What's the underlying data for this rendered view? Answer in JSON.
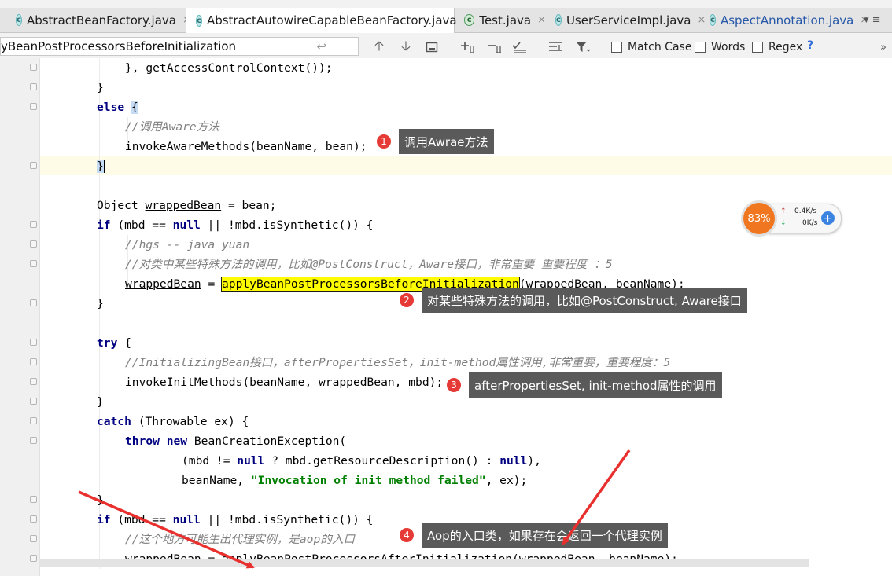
{
  "tabs": [
    {
      "label": "AbstractBeanFactory.java",
      "icon": "class-icon",
      "close": "×"
    },
    {
      "label": "AbstractAutowireCapableBeanFactory.java",
      "icon": "class-icon",
      "close": "×"
    },
    {
      "label": "Test.java",
      "icon": "test-class-icon",
      "close": "×"
    },
    {
      "label": "UserServiceImpl.java",
      "icon": "class-icon",
      "close": "×"
    },
    {
      "label": "AspectAnnotation.java",
      "icon": "class-icon",
      "close": "×"
    }
  ],
  "tab_more": "▾ ≡",
  "find": {
    "query": "yBeanPostProcessorsBeforeInitialization",
    "enter_glyph": "↩",
    "match_case_label": "Match Case",
    "words_label": "Words",
    "regex_label": "Regex",
    "help": "?",
    "more": "»"
  },
  "code": {
    "l1_text": "}, getAccessControlContext());",
    "brace_close": "}",
    "else_kw": "else",
    "brace_open": "{",
    "l4_comment": "//调用Aware方法",
    "l5_text": "invokeAwareMethods(beanName, bean);",
    "l8_a": "Object ",
    "l8_var": "wrappedBean",
    "l8_b": " = bean;",
    "if_kw": "if",
    "if_a": " (mbd == ",
    "null_kw": "null",
    "if_b": " || !mbd.isSynthetic()) {",
    "l10_comment": "//hgs -- java yuan",
    "l11_comment": "//对类中某些特殊方法的调用，比如@PostConstruct，Aware接口，非常重要 重要程度 ：5",
    "l12_var": "wrappedBean",
    "l12_eq": " = ",
    "l12_hl": "applyBeanPostProcessorsBeforeInitialization",
    "l12_rest": "(wrappedBean, beanName);",
    "try_kw": "try",
    "try_rest": " {",
    "l16_comment": "//InitializingBean接口，afterPropertiesSet，init-method属性调用,非常重要，重要程度：5",
    "l17_a": "invokeInitMethods(beanName, ",
    "l17_var": "wrappedBean",
    "l17_b": ", mbd);",
    "catch_kw": "catch",
    "catch_rest": " (Throwable ex) {",
    "throw_kw": "throw",
    "new_kw": "new",
    "l20_rest": " BeanCreationException(",
    "l21_a": "(mbd != ",
    "l21_b": " ? mbd.getResourceDescription() : ",
    "l21_c": "),",
    "l22_a": "beanName, ",
    "l22_str": "\"Invocation of init method failed\"",
    "l22_b": ", ex);",
    "if2_a": " (mbd == ",
    "l25_comment": "//这个地方可能生出代理实例，是aop的入口",
    "l26_var": "wrappedBean",
    "l26_eq": " = applyBeanPostProcessorsAfterInitialization(",
    "l26_var2": "wrappedBean",
    "l26_rest": ", beanName);"
  },
  "callouts": [
    {
      "num": "1",
      "text": "调用Awrae方法"
    },
    {
      "num": "2",
      "text": "对某些特殊方法的调用，比如@PostConstruct, Aware接口"
    },
    {
      "num": "3",
      "text": "afterPropertiesSet, init-method属性的调用"
    },
    {
      "num": "4",
      "text": "Aop的入口类，如果存在会返回一个代理实例"
    }
  ],
  "net_widget": {
    "percent": "83%",
    "upload": "0.4K/s",
    "download": "0K/s",
    "up_arrow": "↑",
    "down_arrow": "↓",
    "plus": "+"
  },
  "colors": {
    "keyword": "#000080",
    "comment": "#808080",
    "string": "#008000",
    "highlight": "#fffb00",
    "callout_bg": "#5a5a5a",
    "badge": "#e53a35",
    "arrow": "#e8312f"
  }
}
